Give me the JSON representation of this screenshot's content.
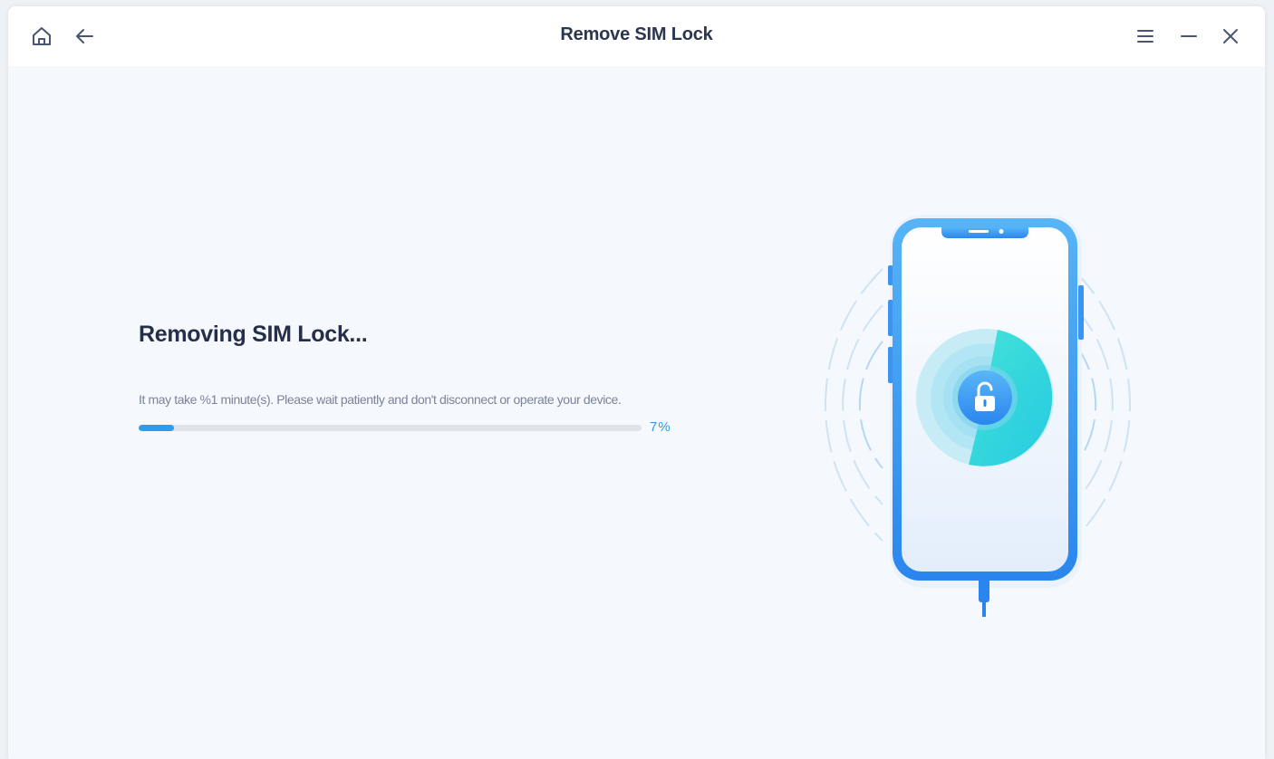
{
  "window": {
    "title": "Remove SIM Lock",
    "icons": {
      "home": "home-icon",
      "back": "arrow-left-icon",
      "menu": "menu-icon",
      "minimize": "minimize-icon",
      "close": "close-icon"
    }
  },
  "main": {
    "heading": "Removing SIM Lock...",
    "description": "It may take %1 minute(s). Please wait patiently and don't disconnect or operate your device.",
    "progress": {
      "value": 7,
      "label": "7%"
    }
  },
  "colors": {
    "accent": "#2b9cf2",
    "title_text": "#2b3650",
    "heading_text": "#252f4a",
    "muted_text": "#7a8399",
    "background": "#f5f8fc",
    "phone_frame": "#2f8ff0",
    "scan_cyan": "#2fd8d0"
  }
}
